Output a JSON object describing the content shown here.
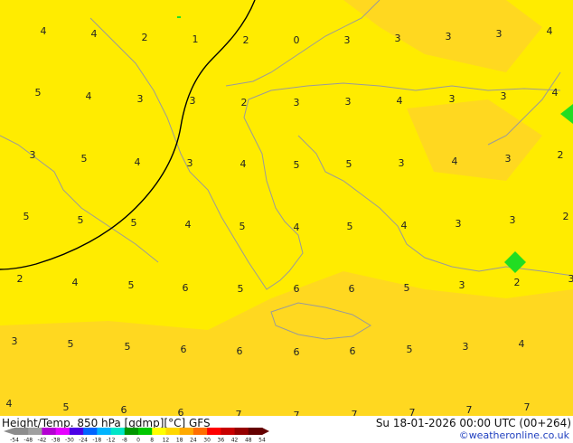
{
  "map": {
    "background_color": "#ffec00",
    "warm_color": "#ffd820",
    "coast_color": "#9a9a9a",
    "isoline_color": "#000000",
    "small_region_color": "#22dd22",
    "values": [
      {
        "t": "4"
      },
      {
        "t": "4"
      },
      {
        "t": "2"
      },
      {
        "t": "1"
      },
      {
        "t": "2"
      },
      {
        "t": "0"
      },
      {
        "t": "3"
      },
      {
        "t": "3"
      },
      {
        "t": "3"
      },
      {
        "t": "3"
      },
      {
        "t": "4"
      },
      {
        "t": "5"
      },
      {
        "t": "4"
      },
      {
        "t": "3"
      },
      {
        "t": "3"
      },
      {
        "t": "2"
      },
      {
        "t": "3"
      },
      {
        "t": "3"
      },
      {
        "t": "4"
      },
      {
        "t": "3"
      },
      {
        "t": "3"
      },
      {
        "t": "4"
      },
      {
        "t": "3"
      },
      {
        "t": "5"
      },
      {
        "t": "4"
      },
      {
        "t": "3"
      },
      {
        "t": "4"
      },
      {
        "t": "5"
      },
      {
        "t": "5"
      },
      {
        "t": "3"
      },
      {
        "t": "4"
      },
      {
        "t": "3"
      },
      {
        "t": "2"
      },
      {
        "t": "5"
      },
      {
        "t": "5"
      },
      {
        "t": "5"
      },
      {
        "t": "4"
      },
      {
        "t": "5"
      },
      {
        "t": "4"
      },
      {
        "t": "5"
      },
      {
        "t": "4"
      },
      {
        "t": "3"
      },
      {
        "t": "3"
      },
      {
        "t": "2"
      },
      {
        "t": "2"
      },
      {
        "t": "4"
      },
      {
        "t": "5"
      },
      {
        "t": "6"
      },
      {
        "t": "5"
      },
      {
        "t": "6"
      },
      {
        "t": "6"
      },
      {
        "t": "5"
      },
      {
        "t": "3"
      },
      {
        "t": "2"
      },
      {
        "t": "3"
      },
      {
        "t": "3"
      },
      {
        "t": "5"
      },
      {
        "t": "5"
      },
      {
        "t": "6"
      },
      {
        "t": "6"
      },
      {
        "t": "6"
      },
      {
        "t": "6"
      },
      {
        "t": "5"
      },
      {
        "t": "3"
      },
      {
        "t": "4"
      },
      {
        "t": "4"
      },
      {
        "t": "5"
      },
      {
        "t": "6"
      },
      {
        "t": "6"
      },
      {
        "t": "7"
      },
      {
        "t": "7"
      },
      {
        "t": "7"
      },
      {
        "t": "7"
      },
      {
        "t": "7"
      },
      {
        "t": "7"
      }
    ]
  },
  "footer": {
    "title_left": "Height/Temp. 850 hPa [gdmp][°C] GFS",
    "title_right": "Su 18-01-2026 00:00 UTC (00+264)",
    "credit": "©weatheronline.co.uk"
  },
  "colorbar": {
    "ticks": [
      "-54",
      "-48",
      "-42",
      "-38",
      "-30",
      "-24",
      "-18",
      "-12",
      "-8",
      "0",
      "8",
      "12",
      "18",
      "24",
      "30",
      "36",
      "42",
      "48",
      "54"
    ],
    "colors": [
      "#8c8c8c",
      "#a0a0a0",
      "#b400d2",
      "#e600ff",
      "#4b00e6",
      "#0064ff",
      "#00b4ff",
      "#00e6c8",
      "#009600",
      "#00c800",
      "#ffff00",
      "#ffd700",
      "#ffaa00",
      "#ff6e00",
      "#ff0000",
      "#c80000",
      "#960000",
      "#640000"
    ]
  }
}
